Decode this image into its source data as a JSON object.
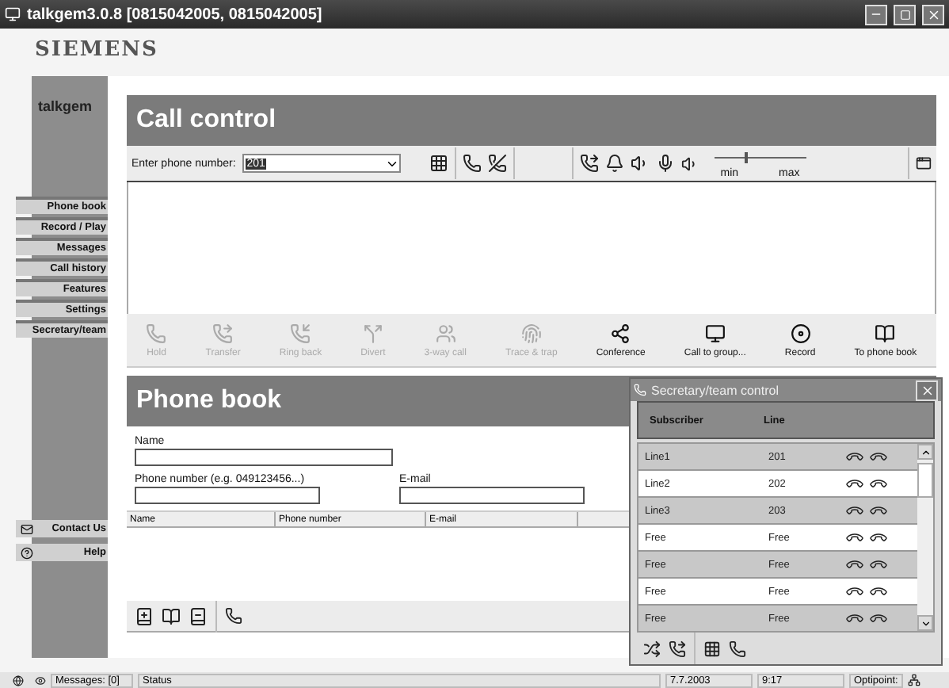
{
  "window": {
    "title": "talkgem3.0.8 [0815042005, 0815042005]"
  },
  "logo": "SIEMENS",
  "sidebar": {
    "title": "talkgem",
    "items": [
      {
        "label": "Phone book"
      },
      {
        "label": "Record / Play"
      },
      {
        "label": "Messages"
      },
      {
        "label": "Call history"
      },
      {
        "label": "Features"
      },
      {
        "label": "Settings"
      },
      {
        "label": "Secretary/team"
      }
    ],
    "links": [
      {
        "label": "Contact Us"
      },
      {
        "label": "Help"
      }
    ]
  },
  "call_control": {
    "title": "Call control",
    "phone_label": "Enter phone number:",
    "phone_value": "201",
    "volume": {
      "level": 0.33,
      "min_label": "min",
      "max_label": "max"
    },
    "actions": [
      {
        "label": "Hold",
        "disabled": true
      },
      {
        "label": "Transfer",
        "disabled": true
      },
      {
        "label": "Ring back",
        "disabled": true
      },
      {
        "label": "Divert",
        "disabled": true
      },
      {
        "label": "3-way call",
        "disabled": true
      },
      {
        "label": "Trace & trap",
        "disabled": true
      },
      {
        "label": "Conference",
        "disabled": false
      },
      {
        "label": "Call to group...",
        "disabled": false
      },
      {
        "label": "Record",
        "disabled": false
      },
      {
        "label": "To phone book",
        "disabled": false
      }
    ]
  },
  "phone_book": {
    "title": "Phone book",
    "name_label": "Name",
    "phone_label": "Phone number (e.g. 049123456...)",
    "email_label": "E-mail",
    "columns": [
      "Name",
      "Phone number",
      "E-mail"
    ]
  },
  "secretary": {
    "title": "Secretary/team control",
    "columns": [
      "Subscriber",
      "Line"
    ],
    "rows": [
      {
        "subscriber": "Line1",
        "line": "201"
      },
      {
        "subscriber": "Line2",
        "line": "202"
      },
      {
        "subscriber": "Line3",
        "line": "203"
      },
      {
        "subscriber": "Free",
        "line": "Free"
      },
      {
        "subscriber": "Free",
        "line": "Free"
      },
      {
        "subscriber": "Free",
        "line": "Free"
      },
      {
        "subscriber": "Free",
        "line": "Free"
      }
    ]
  },
  "status_bar": {
    "messages": "Messages: [0]",
    "status": "Status",
    "date": "7.7.2003",
    "time": "9:17",
    "device": "Optipoint:"
  }
}
